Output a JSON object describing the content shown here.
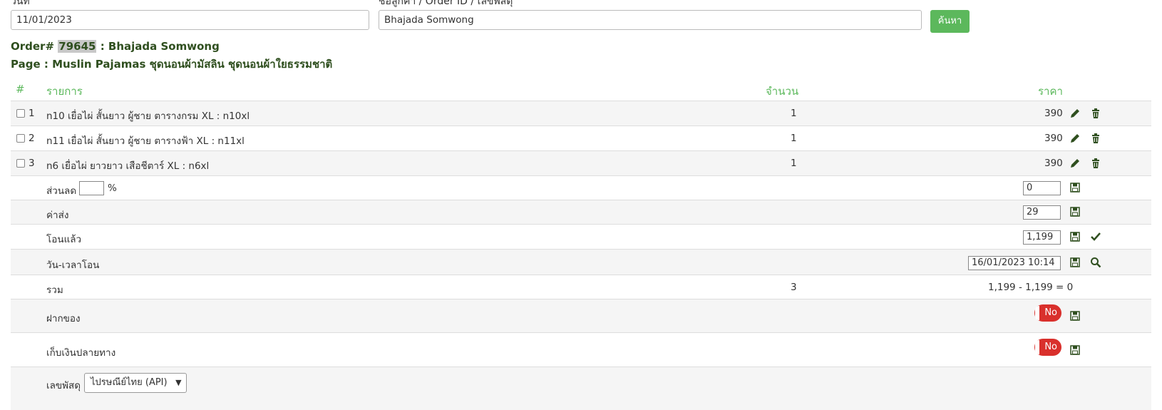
{
  "search": {
    "date_label": "วันที่",
    "date_value": "11/01/2023",
    "customer_label": "ชื่อลูกค้า / Order ID / เลขพัสดุ",
    "customer_value": "Bhajada Somwong",
    "search_button": "ค้นหา"
  },
  "order": {
    "prefix": "Order#",
    "id": "79645",
    "customer": ": Bhajada Somwong",
    "page_line": "Page : Muslin Pajamas ชุดนอนผ้ามัสลิน ชุดนอนผ้าใยธรรมชาติ"
  },
  "table": {
    "headers": {
      "num": "#",
      "item": "รายการ",
      "qty": "จำนวน",
      "price": "ราคา"
    },
    "rows": [
      {
        "num": "1",
        "item": "n10 เยื่อไผ่ สั้นยาว ผู้ชาย ตารางกรม XL : n10xl",
        "qty": "1",
        "price": "390"
      },
      {
        "num": "2",
        "item": "n11 เยื่อไผ่ สั้นยาว ผู้ชาย ตารางฟ้า XL : n11xl",
        "qty": "1",
        "price": "390"
      },
      {
        "num": "3",
        "item": "n6 เยื่อไผ่ ยาวยาว เสือชีตาร์ XL : n6xl",
        "qty": "1",
        "price": "390"
      }
    ]
  },
  "summary": {
    "discount_label": "ส่วนลด",
    "discount_unit": "%",
    "discount_percent_value": "",
    "discount_value": "0",
    "shipping_label": "ค่าส่ง",
    "shipping_value": "29",
    "paid_label": "โอนแล้ว",
    "paid_value": "1,199",
    "transfer_time_label": "วัน-เวลาโอน",
    "transfer_time_value": "16/01/2023 10:14",
    "total_label": "รวม",
    "total_qty": "3",
    "total_calc": "1,199 - 1,199 = 0",
    "deposit_label": "ฝากของ",
    "deposit_toggle": "No",
    "cod_label": "เก็บเงินปลายทาง",
    "cod_toggle": "No",
    "tracking_label": "เลขพัสดุ",
    "tracking_carrier": "ไปรษณีย์ไทย (API)"
  },
  "icons": {
    "edit": "pencil-icon",
    "delete": "trash-icon",
    "save": "floppy-disk-icon",
    "confirm": "checkmark-icon",
    "search": "magnifier-icon",
    "dropdown": "chevron-down-icon"
  },
  "colors": {
    "accent_green": "#5cb85c",
    "dark_green_text": "#2f4f1f",
    "toggle_red": "#d9302c"
  }
}
